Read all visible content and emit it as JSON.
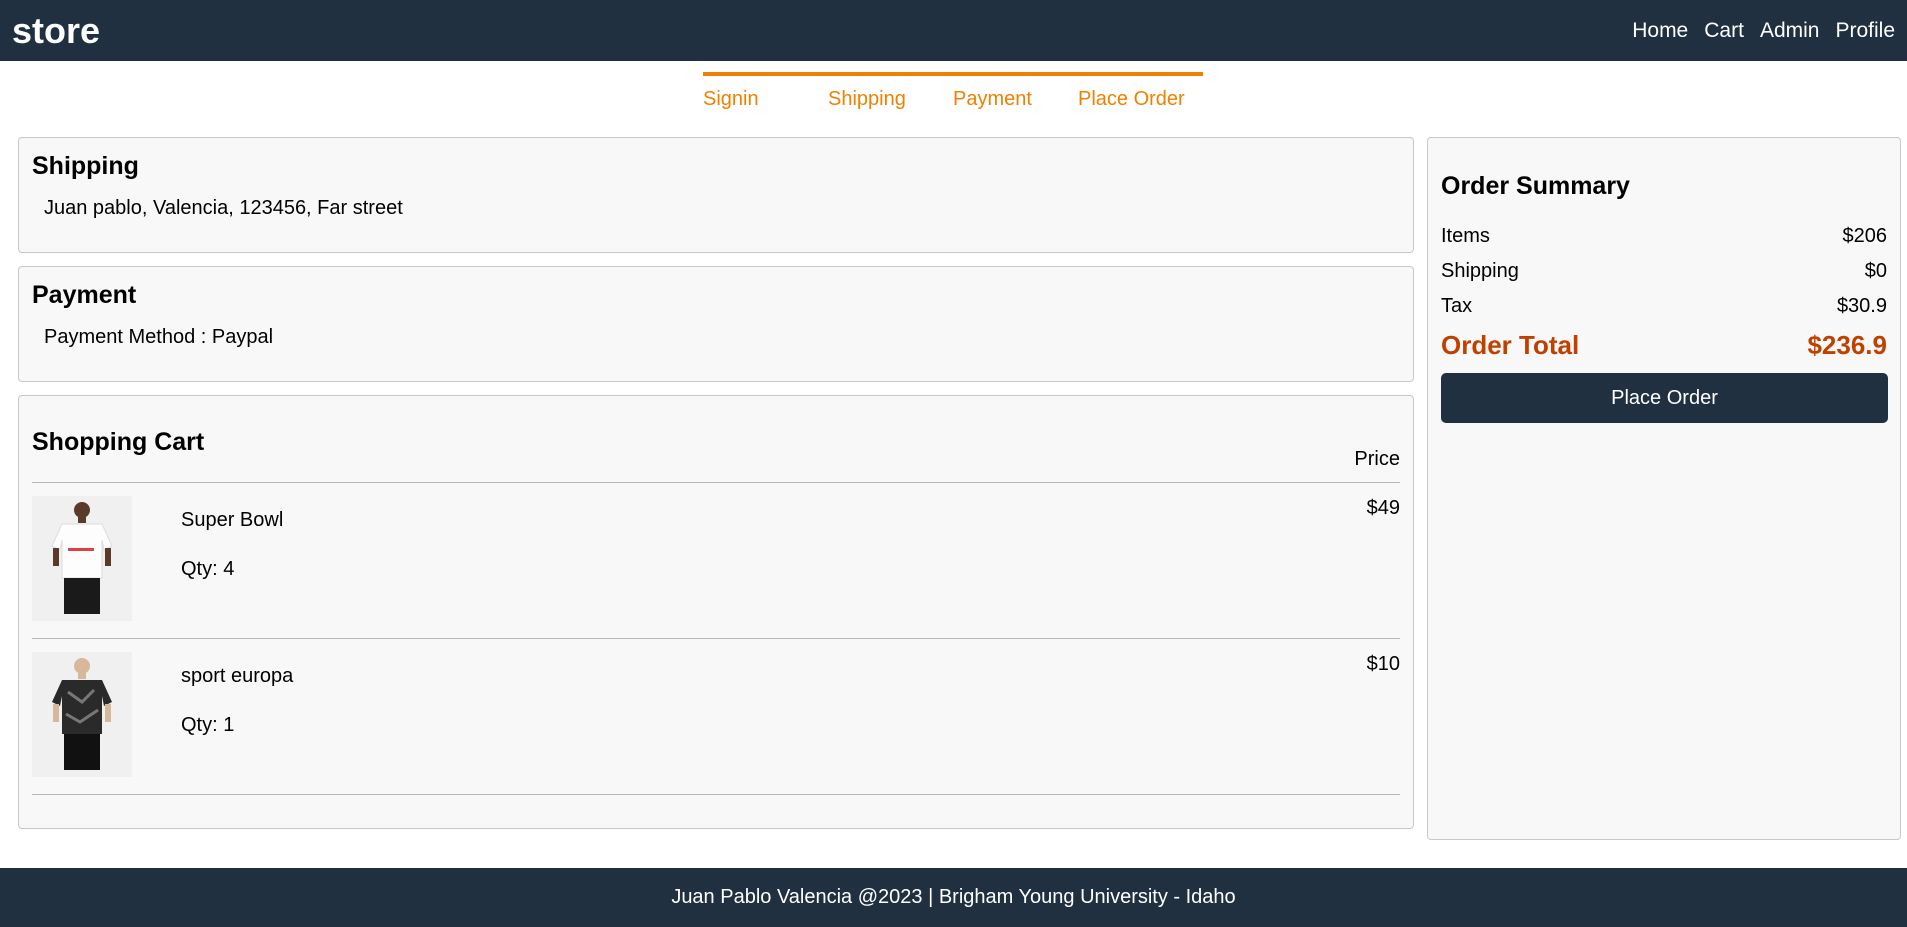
{
  "header": {
    "brand": "store",
    "nav": [
      "Home",
      "Cart",
      "Admin",
      "Profile"
    ]
  },
  "steps": [
    "Signin",
    "Shipping",
    "Payment",
    "Place Order"
  ],
  "shipping": {
    "title": "Shipping",
    "address": "Juan pablo, Valencia, 123456, Far street"
  },
  "payment": {
    "title": "Payment",
    "method": "Payment Method : Paypal"
  },
  "cart": {
    "title": "Shopping Cart",
    "price_header": "Price",
    "items": [
      {
        "name": "Super Bowl",
        "qty": "Qty: 4",
        "price": "$49",
        "image_icon": "white-jersey-model-image"
      },
      {
        "name": "sport europa",
        "qty": "Qty: 1",
        "price": "$10",
        "image_icon": "black-jersey-model-image"
      }
    ]
  },
  "summary": {
    "title": "Order Summary",
    "items_label": "Items",
    "items_value": "$206",
    "shipping_label": "Shipping",
    "shipping_value": "$0",
    "tax_label": "Tax",
    "tax_value": "$30.9",
    "total_label": "Order Total",
    "total_value": "$236.9",
    "button_label": "Place Order"
  },
  "footer": {
    "text": "Juan Pablo Valencia @2023 | Brigham Young University - Idaho"
  },
  "colors": {
    "header_bg": "#203040",
    "accent_orange": "#f08000",
    "total_color": "#c04000"
  }
}
